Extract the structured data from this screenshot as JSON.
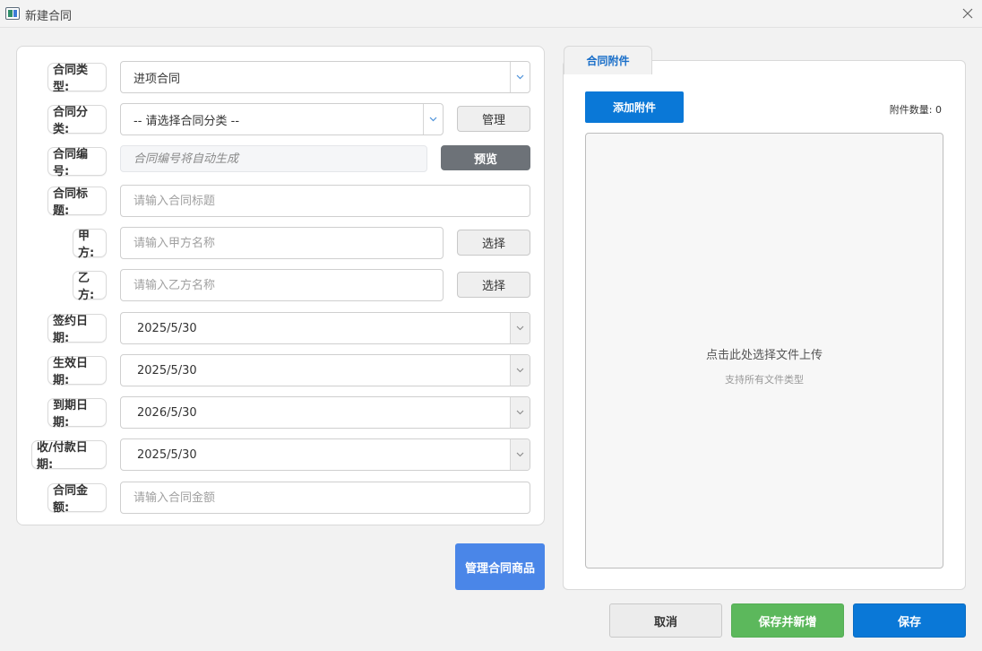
{
  "window": {
    "title": "新建合同"
  },
  "form": {
    "contract_type": {
      "label": "合同类型:",
      "value": "进项合同"
    },
    "contract_category": {
      "label": "合同分类:",
      "value": "-- 请选择合同分类 --",
      "manage_label": "管理"
    },
    "contract_number": {
      "label": "合同编号:",
      "placeholder": "合同编号将自动生成",
      "preview_label": "预览"
    },
    "contract_title": {
      "label": "合同标题:",
      "placeholder": "请输入合同标题"
    },
    "party_a": {
      "label": "甲方:",
      "placeholder": "请输入甲方名称",
      "select_label": "选择"
    },
    "party_b": {
      "label": "乙方:",
      "placeholder": "请输入乙方名称",
      "select_label": "选择"
    },
    "sign_date": {
      "label": "签约日期:",
      "value": "2025/5/30"
    },
    "effective_date": {
      "label": "生效日期:",
      "value": "2025/5/30"
    },
    "expiry_date": {
      "label": "到期日期:",
      "value": "2026/5/30"
    },
    "payment_date": {
      "label": "收/付款日期:",
      "value": "2025/5/30"
    },
    "amount": {
      "label": "合同金额:",
      "placeholder": "请输入合同金额"
    }
  },
  "manage_goods_label": "管理合同商品",
  "attachments": {
    "tab_label": "合同附件",
    "add_label": "添加附件",
    "count_text": "附件数量: 0",
    "drop_main": "点击此处选择文件上传",
    "drop_sub": "支持所有文件类型"
  },
  "footer": {
    "cancel_label": "取消",
    "save_new_label": "保存并新增",
    "save_label": "保存"
  },
  "colors": {
    "primary": "#0a78d7",
    "manage_goods": "#4a86e8",
    "success": "#5cb85c",
    "preview_button": "#6d7278",
    "tab_text": "#1a6fc9"
  }
}
